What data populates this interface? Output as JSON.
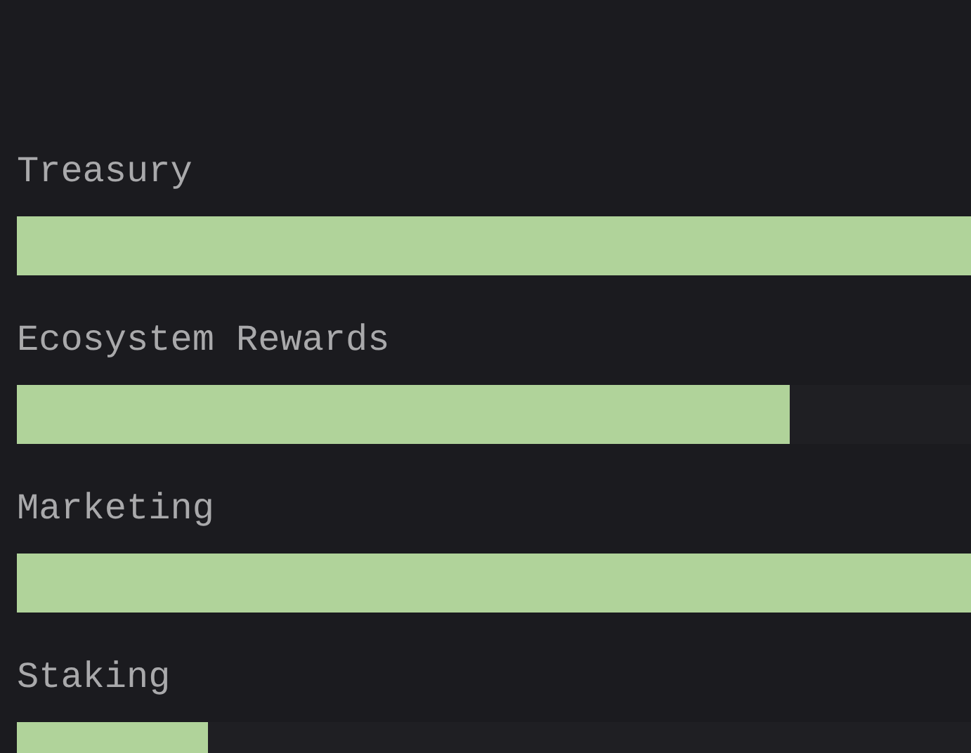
{
  "allocations": [
    {
      "label": "Treasury",
      "level": 1
    },
    {
      "label": "Ecosystem Rewards",
      "level": 0.81
    },
    {
      "label": "Marketing",
      "level": 1
    },
    {
      "label": "Staking",
      "level": 0.2
    }
  ]
}
